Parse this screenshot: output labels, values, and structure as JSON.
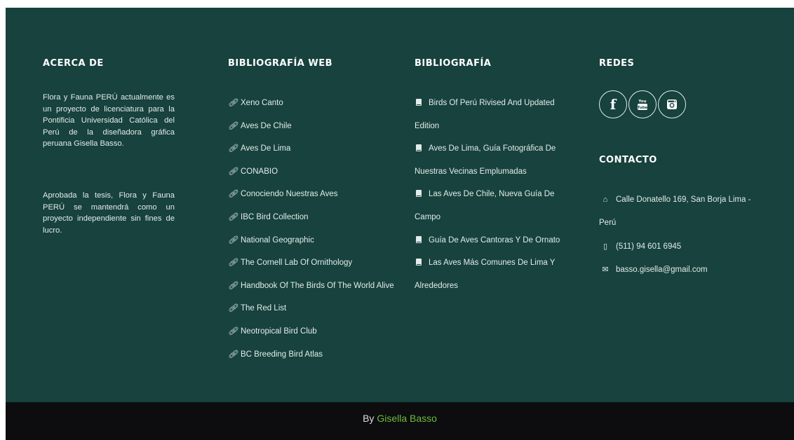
{
  "about": {
    "title": "ACERCA DE",
    "paragraph1": "Flora y Fauna PERÚ actualmente es un proyecto de licenciatura para la Pontificia Universidad Católica del Perú de la diseñadora gráfica peruana Gisella Basso.",
    "paragraph2": "Aprobada la tesis, Flora y Fauna PERÚ se mantendrá como un proyecto independiente sin fines de lucro."
  },
  "web_bibliography": {
    "title": "BIBLIOGRAFÍA WEB",
    "links": [
      "Xeno Canto",
      "Aves De Chile",
      "Aves De Lima",
      "CONABIO",
      "Conociendo Nuestras Aves",
      "IBC Bird Collection",
      "National Geographic",
      "The Cornell Lab Of Ornithology",
      "Handbook Of The Birds Of The World Alive",
      "The Red List",
      "Neotropical Bird Club",
      "BC Breeding Bird Atlas"
    ],
    "icon": "link-icon"
  },
  "bibliography": {
    "title": "BIBLIOGRAFÍA",
    "books": [
      "Birds Of Perú Rivised And Updated Edition",
      "Aves De Lima, Guía Fotográfica De Nuestras Vecinas Emplumadas",
      "Las Aves De Chile, Nueva Guía De Campo",
      "Guía De Aves Cantoras Y De Ornato",
      "Las Aves Más Comunes De Lima Y Alrededores"
    ],
    "icon": "book-icon"
  },
  "social": {
    "title": "REDES",
    "networks": [
      {
        "name": "facebook",
        "icon": "facebook-icon"
      },
      {
        "name": "youtube",
        "icon": "youtube-icon"
      },
      {
        "name": "instagram",
        "icon": "instagram-icon"
      }
    ]
  },
  "contact": {
    "title": "CONTACTO",
    "address": "Calle Donatello 169, San Borja Lima - Perú",
    "phone": "(511) 94 601 6945",
    "email": "basso.gisella@gmail.com"
  },
  "credits": {
    "prefix": "By",
    "author": "Gisella Basso"
  },
  "colors": {
    "background": "#17423e",
    "bottom_bar": "#0d0d0f",
    "text": "#e3ece9",
    "author_accent": "#6dbb3e"
  }
}
